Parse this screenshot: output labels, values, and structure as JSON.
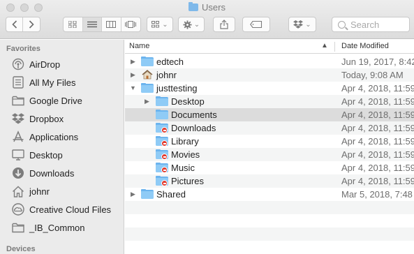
{
  "window": {
    "title": "Users"
  },
  "search": {
    "placeholder": "Search"
  },
  "sidebar": {
    "favorites_heading": "Favorites",
    "devices_heading": "Devices",
    "items": [
      {
        "label": "AirDrop",
        "icon": "airdrop-icon"
      },
      {
        "label": "All My Files",
        "icon": "all-files-icon"
      },
      {
        "label": "Google Drive",
        "icon": "folder-icon"
      },
      {
        "label": "Dropbox",
        "icon": "dropbox-icon"
      },
      {
        "label": "Applications",
        "icon": "applications-icon"
      },
      {
        "label": "Desktop",
        "icon": "desktop-icon"
      },
      {
        "label": "Downloads",
        "icon": "downloads-icon"
      },
      {
        "label": "johnr",
        "icon": "home-icon"
      },
      {
        "label": "Creative Cloud Files",
        "icon": "creative-cloud-icon"
      },
      {
        "label": "_IB_Common",
        "icon": "folder-icon"
      }
    ]
  },
  "list": {
    "header_name": "Name",
    "header_date": "Date Modified",
    "rows": [
      {
        "name": "edtech",
        "date": "Jun 19, 2017, 8:42",
        "icon": "folder-icon",
        "disclosure": "collapsed"
      },
      {
        "name": "johnr",
        "date": "Today, 9:08 AM",
        "icon": "home-icon",
        "disclosure": "collapsed"
      },
      {
        "name": "justtesting",
        "date": "Apr 4, 2018, 11:59",
        "icon": "folder-icon",
        "disclosure": "expanded"
      },
      {
        "name": "Desktop",
        "date": "Apr 4, 2018, 11:59",
        "icon": "folder-icon",
        "disclosure": "collapsed"
      },
      {
        "name": "Documents",
        "date": "Apr 4, 2018, 11:59",
        "icon": "folder-icon",
        "disclosure": "none",
        "selected": true
      },
      {
        "name": "Downloads",
        "date": "Apr 4, 2018, 11:59",
        "icon": "restricted-folder-icon",
        "disclosure": "none"
      },
      {
        "name": "Library",
        "date": "Apr 4, 2018, 11:59",
        "icon": "restricted-folder-icon",
        "disclosure": "none"
      },
      {
        "name": "Movies",
        "date": "Apr 4, 2018, 11:59",
        "icon": "restricted-folder-icon",
        "disclosure": "none"
      },
      {
        "name": "Music",
        "date": "Apr 4, 2018, 11:59",
        "icon": "restricted-folder-icon",
        "disclosure": "none"
      },
      {
        "name": "Pictures",
        "date": "Apr 4, 2018, 11:59",
        "icon": "restricted-folder-icon",
        "disclosure": "none"
      },
      {
        "name": "Shared",
        "date": "Mar 5, 2018, 7:48",
        "icon": "folder-icon",
        "disclosure": "collapsed"
      }
    ]
  }
}
